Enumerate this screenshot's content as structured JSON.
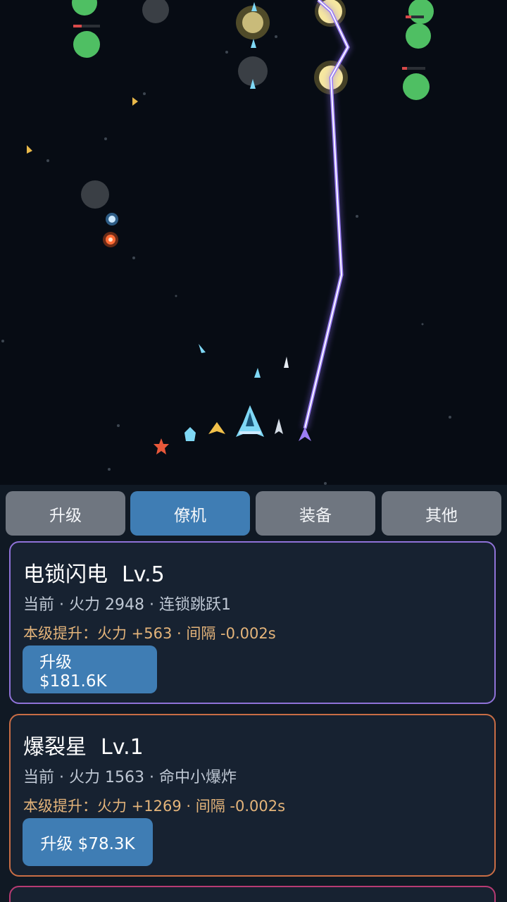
{
  "tabs": [
    {
      "label": "升级",
      "active": false
    },
    {
      "label": "僚机",
      "active": true
    },
    {
      "label": "装备",
      "active": false
    },
    {
      "label": "其他",
      "active": false
    }
  ],
  "cards": [
    {
      "name": "电锁闪电",
      "level": "Lv.5",
      "stats": "当前 · 火力 2948 · 连锁跳跃1",
      "boost": "本级提升：火力 +563 · 间隔 -0.002s",
      "button": "升级 $181.6K",
      "border_color": "#8f72d8"
    },
    {
      "name": "爆裂星",
      "level": "Lv.1",
      "stats": "当前 · 火力 1563 · 命中小爆炸",
      "boost": "本级提升：火力 +1269 · 间隔 -0.002s",
      "button": "升级 $78.3K",
      "border_color": "#c96d45"
    }
  ],
  "colors": {
    "accent": "#3f7db4",
    "lightning": "#9b7df5",
    "enemy_green": "#4fbf63",
    "enemy_gray": "#3a3f45",
    "gold": "#f6e7a0"
  }
}
